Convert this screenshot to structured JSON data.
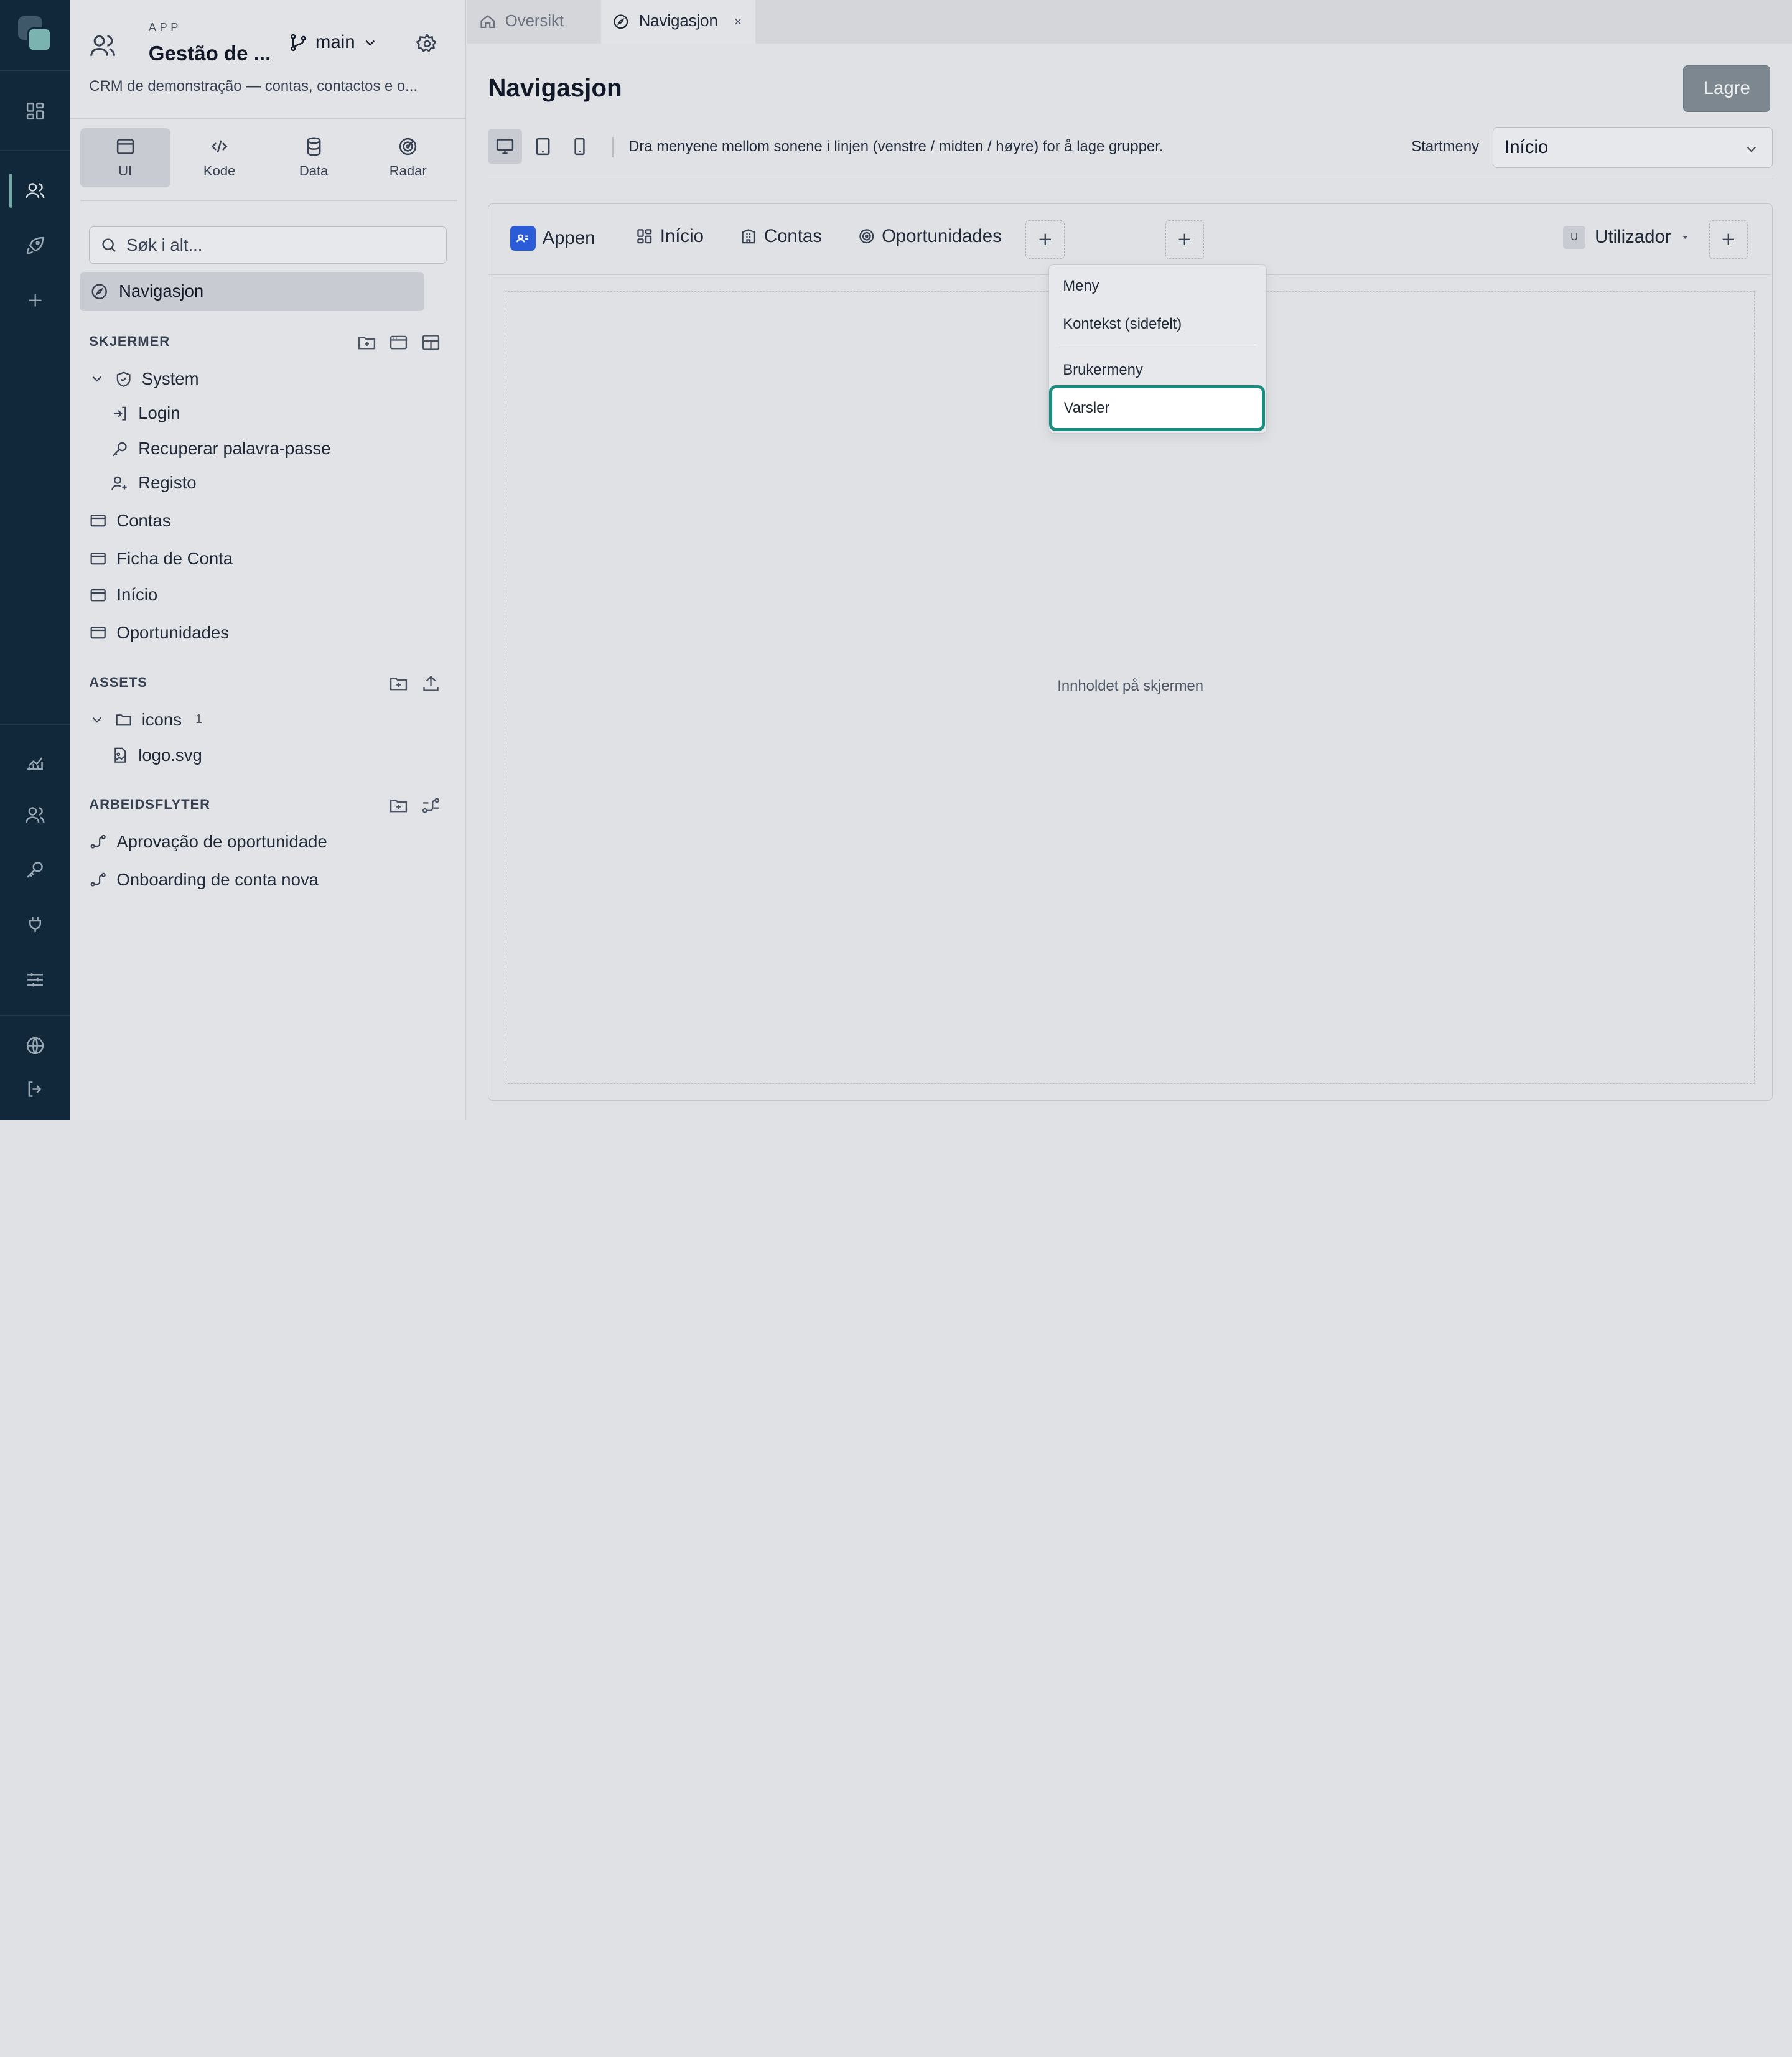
{
  "app": {
    "kicker": "APP",
    "title": "Gestão de ...",
    "branch": "main",
    "description": "CRM de demonstração — contas, contactos e o..."
  },
  "modes": [
    {
      "label": "UI",
      "icon": "window-icon"
    },
    {
      "label": "Kode",
      "icon": "code-icon"
    },
    {
      "label": "Data",
      "icon": "database-icon"
    },
    {
      "label": "Radar",
      "icon": "radar-icon"
    }
  ],
  "search": {
    "placeholder": "Søk i alt..."
  },
  "nav_active": "Navigasjon",
  "sections": {
    "screens": "SKJERMER",
    "assets": "ASSETS",
    "workflows": "ARBEIDSFLYTER"
  },
  "screens": {
    "system_group": "System",
    "system_items": [
      "Login",
      "Recuperar palavra-passe",
      "Registo"
    ],
    "items": [
      "Contas",
      "Ficha de Conta",
      "Início",
      "Oportunidades"
    ]
  },
  "assets": {
    "folder": "icons",
    "folder_count": "1",
    "file": "logo.svg"
  },
  "workflows": [
    "Aprovação de oportunidade",
    "Onboarding de conta nova"
  ],
  "tabs": [
    {
      "label": "Oversikt"
    },
    {
      "label": "Navigasjon",
      "close": "×"
    }
  ],
  "page": {
    "title": "Navigasjon",
    "save_label": "Lagre",
    "hint": "Dra menyene mellom sonene i linjen (venstre / midten / høyre) for å lage grupper.",
    "start_label": "Startmeny",
    "start_value": "Início"
  },
  "navbar": {
    "app": "Appen",
    "items": [
      "Início",
      "Contas",
      "Oportunidades"
    ],
    "user_badge": "U",
    "user": "Utilizador"
  },
  "dropdown": {
    "items": [
      "Meny",
      "Kontekst (sidefelt)",
      "Brukermeny",
      "Varsler"
    ]
  },
  "content_label": "Innholdet på skjermen",
  "colors": {
    "rail": "#11283a",
    "accent": "#1b8c80",
    "app_badge": "#2b5bd7",
    "save_button": "#7d8790"
  }
}
